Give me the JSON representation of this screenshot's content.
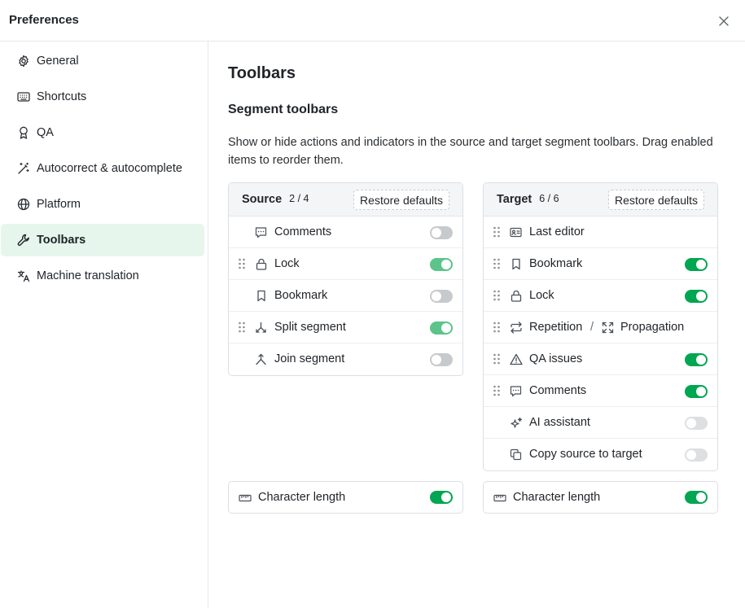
{
  "header": {
    "title": "Preferences"
  },
  "sidebar": {
    "items": [
      {
        "label": "General",
        "icon": "gear-icon"
      },
      {
        "label": "Shortcuts",
        "icon": "keyboard-icon"
      },
      {
        "label": "QA",
        "icon": "award-icon"
      },
      {
        "label": "Autocorrect & autocomplete",
        "icon": "magic-wand-icon"
      },
      {
        "label": "Platform",
        "icon": "globe-icon"
      },
      {
        "label": "Toolbars",
        "icon": "wrench-icon",
        "active": true
      },
      {
        "label": "Machine translation",
        "icon": "translate-icon"
      }
    ]
  },
  "main": {
    "title": "Toolbars",
    "section_title": "Segment toolbars",
    "description": "Show or hide actions and indicators in the source and target segment toolbars. Drag enabled items to reorder them.",
    "source": {
      "title": "Source",
      "count": "2 / 4",
      "restore_label": "Restore defaults",
      "items": [
        {
          "label": "Comments",
          "icon": "comment-icon",
          "enabled": false
        },
        {
          "label": "Lock",
          "icon": "lock-icon",
          "enabled": true
        },
        {
          "label": "Bookmark",
          "icon": "bookmark-icon",
          "enabled": false
        },
        {
          "label": "Split segment",
          "icon": "split-icon",
          "enabled": true
        },
        {
          "label": "Join segment",
          "icon": "join-icon",
          "enabled": false
        }
      ],
      "char_length": {
        "label": "Character length",
        "enabled": true
      }
    },
    "target": {
      "title": "Target",
      "count": "6 / 6",
      "restore_label": "Restore defaults",
      "items": [
        {
          "label": "Last editor",
          "icon": "id-card-icon"
        },
        {
          "label": "Bookmark",
          "icon": "bookmark-icon",
          "enabled": true
        },
        {
          "label": "Lock",
          "icon": "lock-icon",
          "enabled": true
        },
        {
          "label": "Repetition",
          "separator": "/",
          "label2": "Propagation",
          "icon": "repeat-icon",
          "icon2": "expand-icon"
        },
        {
          "label": "QA issues",
          "icon": "warning-icon",
          "enabled": true
        },
        {
          "label": "Comments",
          "icon": "comment-icon",
          "enabled": true
        },
        {
          "label": "AI assistant",
          "icon": "sparkle-icon",
          "enabled": false
        },
        {
          "label": "Copy source to target",
          "icon": "copy-icon",
          "enabled": false
        }
      ],
      "char_length": {
        "label": "Character length",
        "enabled": true
      }
    }
  },
  "colors": {
    "accent": "#00a651",
    "accent_muted": "#5cc489",
    "active_nav_bg": "#e6f6ec",
    "toggle_off": "#c7cacd"
  }
}
